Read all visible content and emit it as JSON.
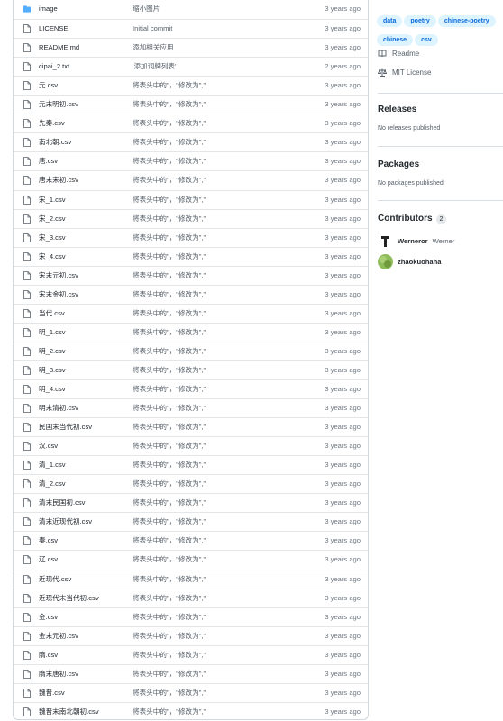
{
  "files": [
    {
      "name": "image",
      "type": "folder",
      "message": "缩小图片",
      "age": "3 years ago"
    },
    {
      "name": "LICENSE",
      "type": "file",
      "message": "Initial commit",
      "age": "3 years ago"
    },
    {
      "name": "README.md",
      "type": "file",
      "message": "添加相关应用",
      "age": "3 years ago"
    },
    {
      "name": "cipai_2.txt",
      "type": "file",
      "message": "'添加词牌列表'",
      "age": "2 years ago"
    },
    {
      "name": "元.csv",
      "type": "file",
      "message": "将表头中的\"，\"修改为\",\"",
      "age": "3 years ago"
    },
    {
      "name": "元末明初.csv",
      "type": "file",
      "message": "将表头中的\"，\"修改为\",\"",
      "age": "3 years ago"
    },
    {
      "name": "先秦.csv",
      "type": "file",
      "message": "将表头中的\"，\"修改为\",\"",
      "age": "3 years ago"
    },
    {
      "name": "南北朝.csv",
      "type": "file",
      "message": "将表头中的\"，\"修改为\",\"",
      "age": "3 years ago"
    },
    {
      "name": "唐.csv",
      "type": "file",
      "message": "将表头中的\"，\"修改为\",\"",
      "age": "3 years ago"
    },
    {
      "name": "唐末宋初.csv",
      "type": "file",
      "message": "将表头中的\"，\"修改为\",\"",
      "age": "3 years ago"
    },
    {
      "name": "宋_1.csv",
      "type": "file",
      "message": "将表头中的\"，\"修改为\",\"",
      "age": "3 years ago"
    },
    {
      "name": "宋_2.csv",
      "type": "file",
      "message": "将表头中的\"，\"修改为\",\"",
      "age": "3 years ago"
    },
    {
      "name": "宋_3.csv",
      "type": "file",
      "message": "将表头中的\"，\"修改为\",\"",
      "age": "3 years ago"
    },
    {
      "name": "宋_4.csv",
      "type": "file",
      "message": "将表头中的\"，\"修改为\",\"",
      "age": "3 years ago"
    },
    {
      "name": "宋末元初.csv",
      "type": "file",
      "message": "将表头中的\"，\"修改为\",\"",
      "age": "3 years ago"
    },
    {
      "name": "宋末金初.csv",
      "type": "file",
      "message": "将表头中的\"，\"修改为\",\"",
      "age": "3 years ago"
    },
    {
      "name": "当代.csv",
      "type": "file",
      "message": "将表头中的\"，\"修改为\",\"",
      "age": "3 years ago"
    },
    {
      "name": "明_1.csv",
      "type": "file",
      "message": "将表头中的\"，\"修改为\",\"",
      "age": "3 years ago"
    },
    {
      "name": "明_2.csv",
      "type": "file",
      "message": "将表头中的\"，\"修改为\",\"",
      "age": "3 years ago"
    },
    {
      "name": "明_3.csv",
      "type": "file",
      "message": "将表头中的\"，\"修改为\",\"",
      "age": "3 years ago"
    },
    {
      "name": "明_4.csv",
      "type": "file",
      "message": "将表头中的\"，\"修改为\",\"",
      "age": "3 years ago"
    },
    {
      "name": "明末清初.csv",
      "type": "file",
      "message": "将表头中的\"，\"修改为\",\"",
      "age": "3 years ago"
    },
    {
      "name": "民国末当代初.csv",
      "type": "file",
      "message": "将表头中的\"，\"修改为\",\"",
      "age": "3 years ago"
    },
    {
      "name": "汉.csv",
      "type": "file",
      "message": "将表头中的\"，\"修改为\",\"",
      "age": "3 years ago"
    },
    {
      "name": "清_1.csv",
      "type": "file",
      "message": "将表头中的\"，\"修改为\",\"",
      "age": "3 years ago"
    },
    {
      "name": "清_2.csv",
      "type": "file",
      "message": "将表头中的\"，\"修改为\",\"",
      "age": "3 years ago"
    },
    {
      "name": "清末民国初.csv",
      "type": "file",
      "message": "将表头中的\"，\"修改为\",\"",
      "age": "3 years ago"
    },
    {
      "name": "清末近现代初.csv",
      "type": "file",
      "message": "将表头中的\"，\"修改为\",\"",
      "age": "3 years ago"
    },
    {
      "name": "秦.csv",
      "type": "file",
      "message": "将表头中的\"，\"修改为\",\"",
      "age": "3 years ago"
    },
    {
      "name": "辽.csv",
      "type": "file",
      "message": "将表头中的\"，\"修改为\",\"",
      "age": "3 years ago"
    },
    {
      "name": "近现代.csv",
      "type": "file",
      "message": "将表头中的\"，\"修改为\",\"",
      "age": "3 years ago"
    },
    {
      "name": "近现代末当代初.csv",
      "type": "file",
      "message": "将表头中的\"，\"修改为\",\"",
      "age": "3 years ago"
    },
    {
      "name": "金.csv",
      "type": "file",
      "message": "将表头中的\"，\"修改为\",\"",
      "age": "3 years ago"
    },
    {
      "name": "金末元初.csv",
      "type": "file",
      "message": "将表头中的\"，\"修改为\",\"",
      "age": "3 years ago"
    },
    {
      "name": "隋.csv",
      "type": "file",
      "message": "将表头中的\"，\"修改为\",\"",
      "age": "3 years ago"
    },
    {
      "name": "隋末唐初.csv",
      "type": "file",
      "message": "将表头中的\"，\"修改为\",\"",
      "age": "3 years ago"
    },
    {
      "name": "魏晋.csv",
      "type": "file",
      "message": "将表头中的\"，\"修改为\",\"",
      "age": "3 years ago"
    },
    {
      "name": "魏晋末南北朝初.csv",
      "type": "file",
      "message": "将表头中的\"，\"修改为\",\"",
      "age": "3 years ago"
    }
  ],
  "sidebar": {
    "topics": [
      "data",
      "poetry",
      "chinese-poetry",
      "chinese",
      "csv"
    ],
    "readme_label": "Readme",
    "license_label": "MIT License",
    "releases": {
      "title": "Releases",
      "empty": "No releases published"
    },
    "packages": {
      "title": "Packages",
      "empty": "No packages published"
    },
    "contributors": {
      "title": "Contributors",
      "count": "2",
      "people": [
        {
          "login": "Werneror",
          "name": "Werner"
        },
        {
          "login": "zhaokuohaha",
          "name": ""
        }
      ]
    }
  },
  "colors": {
    "accent": "#0969da",
    "folder": "#54aeff",
    "topic_bg": "#ddf4ff",
    "border": "#d0d7de"
  }
}
